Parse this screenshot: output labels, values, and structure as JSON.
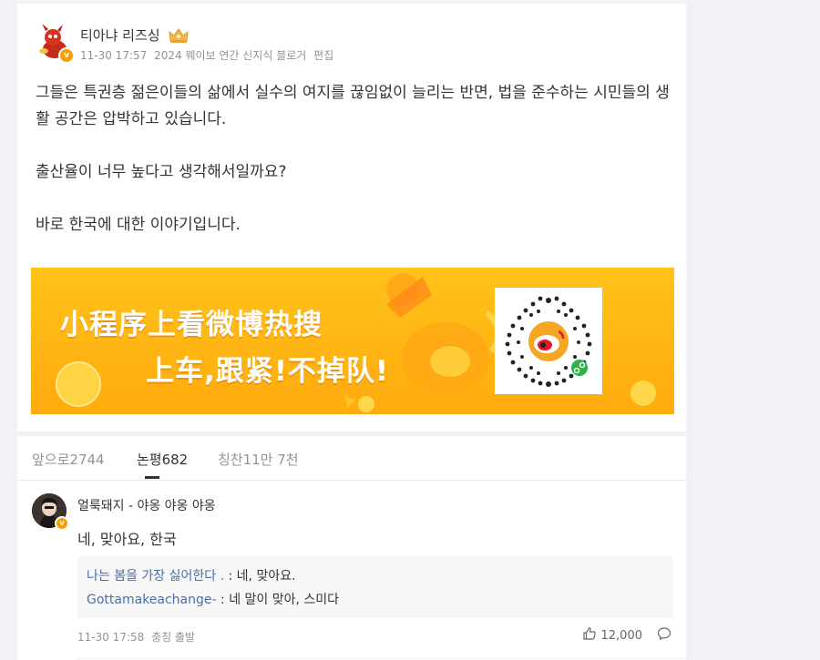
{
  "post": {
    "author": "티아냐 리즈싱",
    "verified_mark": "v",
    "meta": {
      "time": "11-30 17:57",
      "source": "2024 웨이보 연간 신지식 블로거",
      "edited": "편집"
    },
    "paragraphs": [
      "그들은 특권층 젊은이들의 삶에서 실수의 여지를 끊임없이 늘리는 반면, 법을 준수하는 시민들의 생활 공간은 압박하고 있습니다.",
      "출산율이 너무 높다고 생각해서일까요?",
      "바로 한국에 대한 이야기입니다."
    ],
    "banner": {
      "line1": "小程序上看微博热搜",
      "line2": "上车,跟紧!不掉队!",
      "bg_color": "#ffb514",
      "qr_icon": "weibo-qr-code"
    }
  },
  "tabs": [
    {
      "label": "앞으로2744",
      "active": false
    },
    {
      "label": "논평682",
      "active": true
    },
    {
      "label": "칭찬11만 7천",
      "active": false
    }
  ],
  "comment": {
    "user": "얼룩돼지 - 야옹 야옹 야옹",
    "verified_mark": "v",
    "text": "네, 맞아요, 한국",
    "replies": [
      {
        "user": "나는 봄을 가장 싫어한다 .",
        "text": " : 네, 맞아요."
      },
      {
        "user": "Gottamakeachange-",
        "text": " : 네 말이 맞아, 스미다"
      }
    ],
    "meta": {
      "time": "11-30 17:58",
      "location": "충칭 출발"
    },
    "likes": "12,000"
  },
  "colors": {
    "page_bg": "#f1f2f5",
    "link": "#4a6ea8",
    "verified": "#f7a000",
    "muted": "#939393"
  }
}
